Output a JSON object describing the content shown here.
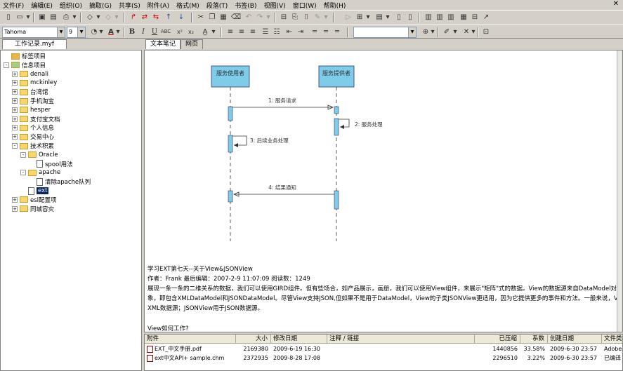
{
  "menu": [
    "文件(F)",
    "编辑(E)",
    "组织(O)",
    "摘取(G)",
    "共享(S)",
    "附件(A)",
    "格式(M)",
    "段落(T)",
    "书签(B)",
    "视图(V)",
    "窗口(W)",
    "帮助(H)"
  ],
  "font": {
    "name": "Tahoma",
    "size": "9"
  },
  "left_tab": "工作记录.myf",
  "tree": [
    {
      "label": "标签项目",
      "level": 0,
      "toggle": "",
      "icon": "tag"
    },
    {
      "label": "信息项目",
      "level": 0,
      "toggle": "-",
      "icon": "note"
    },
    {
      "label": "denali",
      "level": 1,
      "toggle": "+",
      "icon": "folder"
    },
    {
      "label": "mckinley",
      "level": 1,
      "toggle": "+",
      "icon": "folder"
    },
    {
      "label": "台湾馆",
      "level": 1,
      "toggle": "+",
      "icon": "folder"
    },
    {
      "label": "手机淘宝",
      "level": 1,
      "toggle": "+",
      "icon": "folder"
    },
    {
      "label": "hesper",
      "level": 1,
      "toggle": "+",
      "icon": "folder"
    },
    {
      "label": "支付宝文档",
      "level": 1,
      "toggle": "+",
      "icon": "folder"
    },
    {
      "label": "个人信息",
      "level": 1,
      "toggle": "+",
      "icon": "folder"
    },
    {
      "label": "交易中心",
      "level": 1,
      "toggle": "+",
      "icon": "folder"
    },
    {
      "label": "技术积累",
      "level": 1,
      "toggle": "-",
      "icon": "folder"
    },
    {
      "label": "Oracle",
      "level": 2,
      "toggle": "-",
      "icon": "folder"
    },
    {
      "label": "spool用法",
      "level": 3,
      "toggle": "",
      "icon": "doc"
    },
    {
      "label": "apache",
      "level": 2,
      "toggle": "-",
      "icon": "folder"
    },
    {
      "label": "清除apache队列",
      "level": 3,
      "toggle": "",
      "icon": "doc"
    },
    {
      "label": "ext",
      "level": 2,
      "toggle": "",
      "icon": "doc",
      "selected": true
    },
    {
      "label": "esl配置项",
      "level": 1,
      "toggle": "+",
      "icon": "folder"
    },
    {
      "label": "同城容灾",
      "level": 1,
      "toggle": "+",
      "icon": "folder"
    }
  ],
  "right_tabs": [
    "文本笔记",
    "网页"
  ],
  "diagram": {
    "actor1": "服务使用者",
    "actor2": "服务提供者",
    "m1": "1: 服务请求",
    "m2": "2: 服务处理",
    "m3": "3: 后续业务处理",
    "m4": "4: 结果通知"
  },
  "article": {
    "title": "学习EXT第七天--关于View&JSONView",
    "meta": "作者：Frank 最后编辑：2007-2-9 11:07:09 阅读数：1249",
    "p1": "展现一条一条的二维关系的数据，我们可以使用GIRD组件。但有些场合，如产品展示，画册，我们可以使用View组件，来展示\"矩阵\"式的数据。View的数据源来自DataModel对",
    "p2": "象，即包含XMLDataModel和JSONDataModel。尽管View支持JSON,但如果不是用于DataModel，View的子类JSONView更适用，因为它提供更多的事件和方法。一般来说，View用于",
    "p3": "XML数据源；JSONView用于JSON数据源。",
    "p4": "View如何工作?"
  },
  "attachments": {
    "headers": [
      "附件",
      "大小",
      "修改日期",
      "注释 / 链接",
      "已压缩",
      "系数",
      "创建日期",
      "文件类"
    ],
    "rows": [
      [
        "EXT_中文手册.pdf",
        "2169380",
        "2009-6-19 16:30",
        "",
        "1440856",
        "33.58%",
        "2009-6-30 23:57",
        "Adobe A"
      ],
      [
        "ext中文API+ sample.chm",
        "2372935",
        "2009-8-28 17:08",
        "",
        "2296510",
        "3.22%",
        "2009-6-30 23:57",
        "已编译"
      ]
    ]
  },
  "colors": {
    "lifeline_box": "#7ecbea",
    "selection": "#0a246a",
    "chrome": "#d4d0c8"
  }
}
